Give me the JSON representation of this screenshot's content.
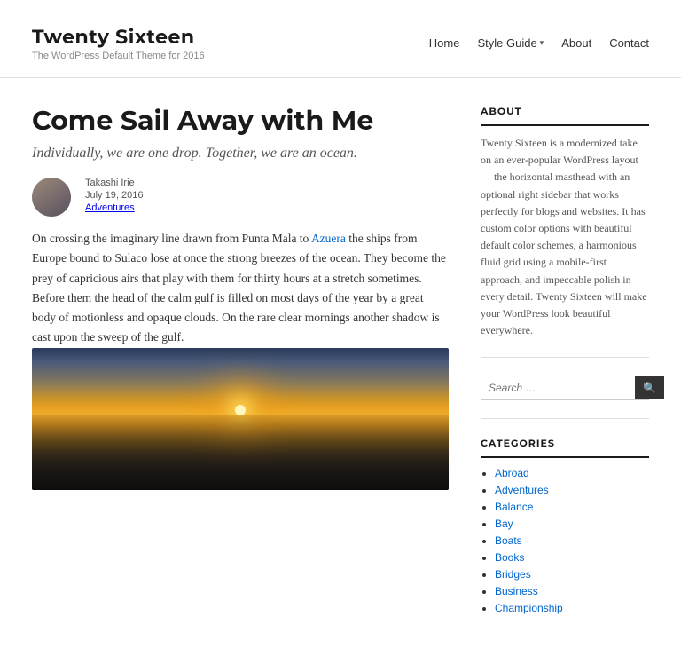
{
  "site": {
    "title": "Twenty Sixteen",
    "description": "The WordPress Default Theme for 2016"
  },
  "nav": {
    "items": [
      {
        "label": "Home",
        "id": "home"
      },
      {
        "label": "Style Guide",
        "id": "style-guide",
        "has_dropdown": true
      },
      {
        "label": "About",
        "id": "about"
      },
      {
        "label": "Contact",
        "id": "contact"
      }
    ]
  },
  "article": {
    "title": "Come Sail Away with Me",
    "subtitle": "Individually, we are one drop. Together, we are an ocean.",
    "author": "Takashi Irie",
    "date": "July 19, 2016",
    "category": "Adventures",
    "body": "On crossing the imaginary line drawn from Punta Mala to Azuera the ships from Europe bound to Sulaco lose at once the strong breezes of the ocean. They become the prey of capricious airs that play with them for thirty hours at a stretch sometimes. Before them the head of the calm gulf is filled on most days of the year by a great body of motionless and opaque clouds. On the rare clear mornings another shadow is cast upon the sweep of the gulf.",
    "link_text": "Azuera"
  },
  "sidebar": {
    "about": {
      "heading": "ABOUT",
      "text": "Twenty Sixteen is a modernized take on an ever-popular WordPress layout — the horizontal masthead with an optional right sidebar that works perfectly for blogs and websites. It has custom color options with beautiful default color schemes, a harmonious fluid grid using a mobile-first approach, and impeccable polish in every detail. Twenty Sixteen will make your WordPress look beautiful everywhere."
    },
    "search": {
      "placeholder": "Search …",
      "button_label": "🔍"
    },
    "categories": {
      "heading": "CATEGORIES",
      "items": [
        "Abroad",
        "Adventures",
        "Balance",
        "Bay",
        "Boats",
        "Books",
        "Bridges",
        "Business",
        "Championship"
      ]
    }
  }
}
